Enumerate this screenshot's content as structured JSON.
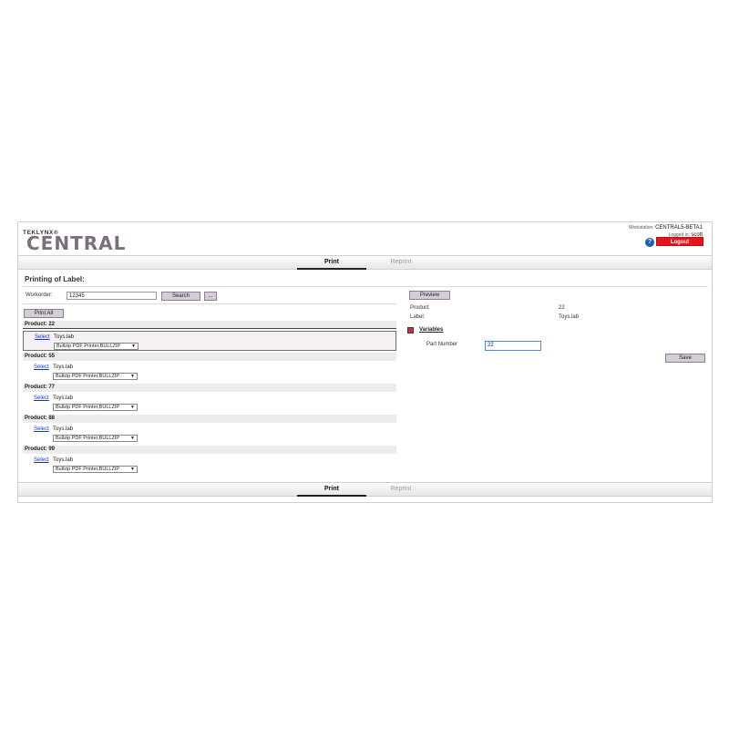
{
  "header": {
    "brand_small": "TEKLYNX®",
    "brand_big": "CENTRAL",
    "workstation_label": "Workstation:",
    "workstation_value": "CENTRAL5-BETA1",
    "logged_label": "Logged in:",
    "logged_value": "scott",
    "help_glyph": "?",
    "logout_label": "Logout"
  },
  "tabs": {
    "print": "Print",
    "reprint": "Reprint"
  },
  "page_title": "Printing of Label:",
  "search": {
    "workorder_label": "Workorder:",
    "workorder_value": "12345",
    "search_label": "Search",
    "browse_label": "..."
  },
  "print_all_label": "Print All",
  "products": [
    {
      "header": "Product:  22",
      "select": "Select",
      "file": "Toys.lab",
      "printer": "Bullzip PDF Printer,BULLZIP"
    },
    {
      "header": "Product:  55",
      "select": "Select",
      "file": "Toys.lab",
      "printer": "Bullzip PDF Printer,BULLZIP"
    },
    {
      "header": "Product:  77",
      "select": "Select",
      "file": "Toys.lab",
      "printer": "Bullzip PDF Printer,BULLZIP"
    },
    {
      "header": "Product:  88",
      "select": "Select",
      "file": "Toys.lab",
      "printer": "Bullzip PDF Printer,BULLZIP"
    },
    {
      "header": "Product:  99",
      "select": "Select",
      "file": "Toys.lab",
      "printer": "Bullzip PDF Printer,BULLZIP"
    }
  ],
  "preview": {
    "preview_label": "Preview",
    "product_label": "Product",
    "product_value": "22",
    "label_label": "Label:",
    "label_value": "Toys.lab",
    "variables_label": "Variables",
    "part_number_label": "Part Number",
    "part_number_value": "22",
    "save_label": "Save"
  },
  "colors": {
    "logout": "#e8141b",
    "button": "#d4cdd8",
    "brand": "#7b6f7d",
    "link": "#1a36c8"
  }
}
